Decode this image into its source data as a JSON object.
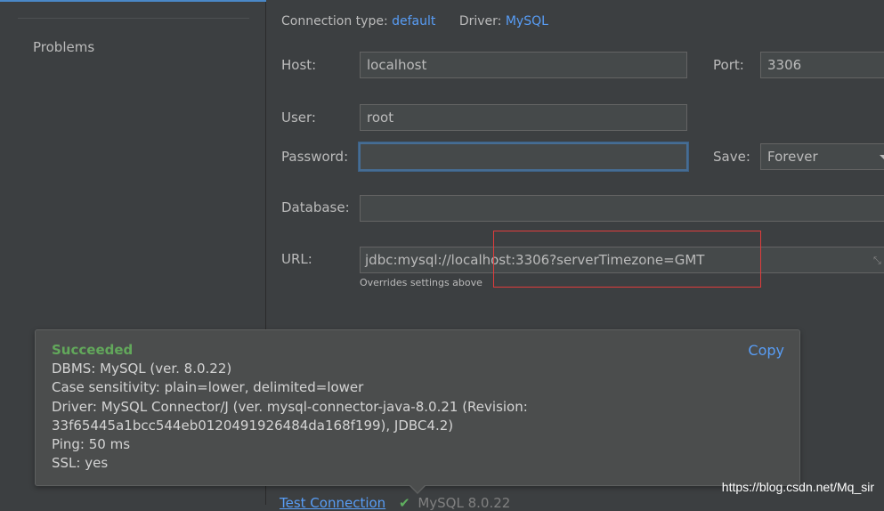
{
  "sidebar": {
    "items": [
      {
        "label": "Problems"
      }
    ]
  },
  "connection": {
    "type_label": "Connection type:",
    "type_value": "default",
    "driver_label": "Driver:",
    "driver_value": "MySQL"
  },
  "form": {
    "host_label": "Host:",
    "host_value": "localhost",
    "port_label": "Port:",
    "port_value": "3306",
    "user_label": "User:",
    "user_value": "root",
    "password_label": "Password:",
    "password_value": "",
    "save_label": "Save:",
    "save_value": "Forever",
    "database_label": "Database:",
    "database_value": "",
    "url_label": "URL:",
    "url_value": "jdbc:mysql://localhost:3306?serverTimezone=GMT",
    "url_hint": "Overrides settings above"
  },
  "result_popup": {
    "status": "Succeeded",
    "copy_label": "Copy",
    "lines": [
      "DBMS: MySQL (ver. 8.0.22)",
      "Case sensitivity: plain=lower, delimited=lower",
      "Driver: MySQL Connector/J (ver. mysql-connector-java-8.0.21 (Revision:",
      "33f65445a1bcc544eb0120491926484da168f199), JDBC4.2)",
      "Ping: 50 ms",
      "SSL: yes"
    ]
  },
  "bottom": {
    "test_connection_label": "Test Connection",
    "check_glyph": "✔",
    "version_text": "MySQL 8.0.22"
  },
  "watermark": "https://blog.csdn.net/Mq_sir",
  "colors": {
    "accent": "#589df6",
    "success": "#62a85b",
    "highlight_box": "#e03c3c"
  }
}
